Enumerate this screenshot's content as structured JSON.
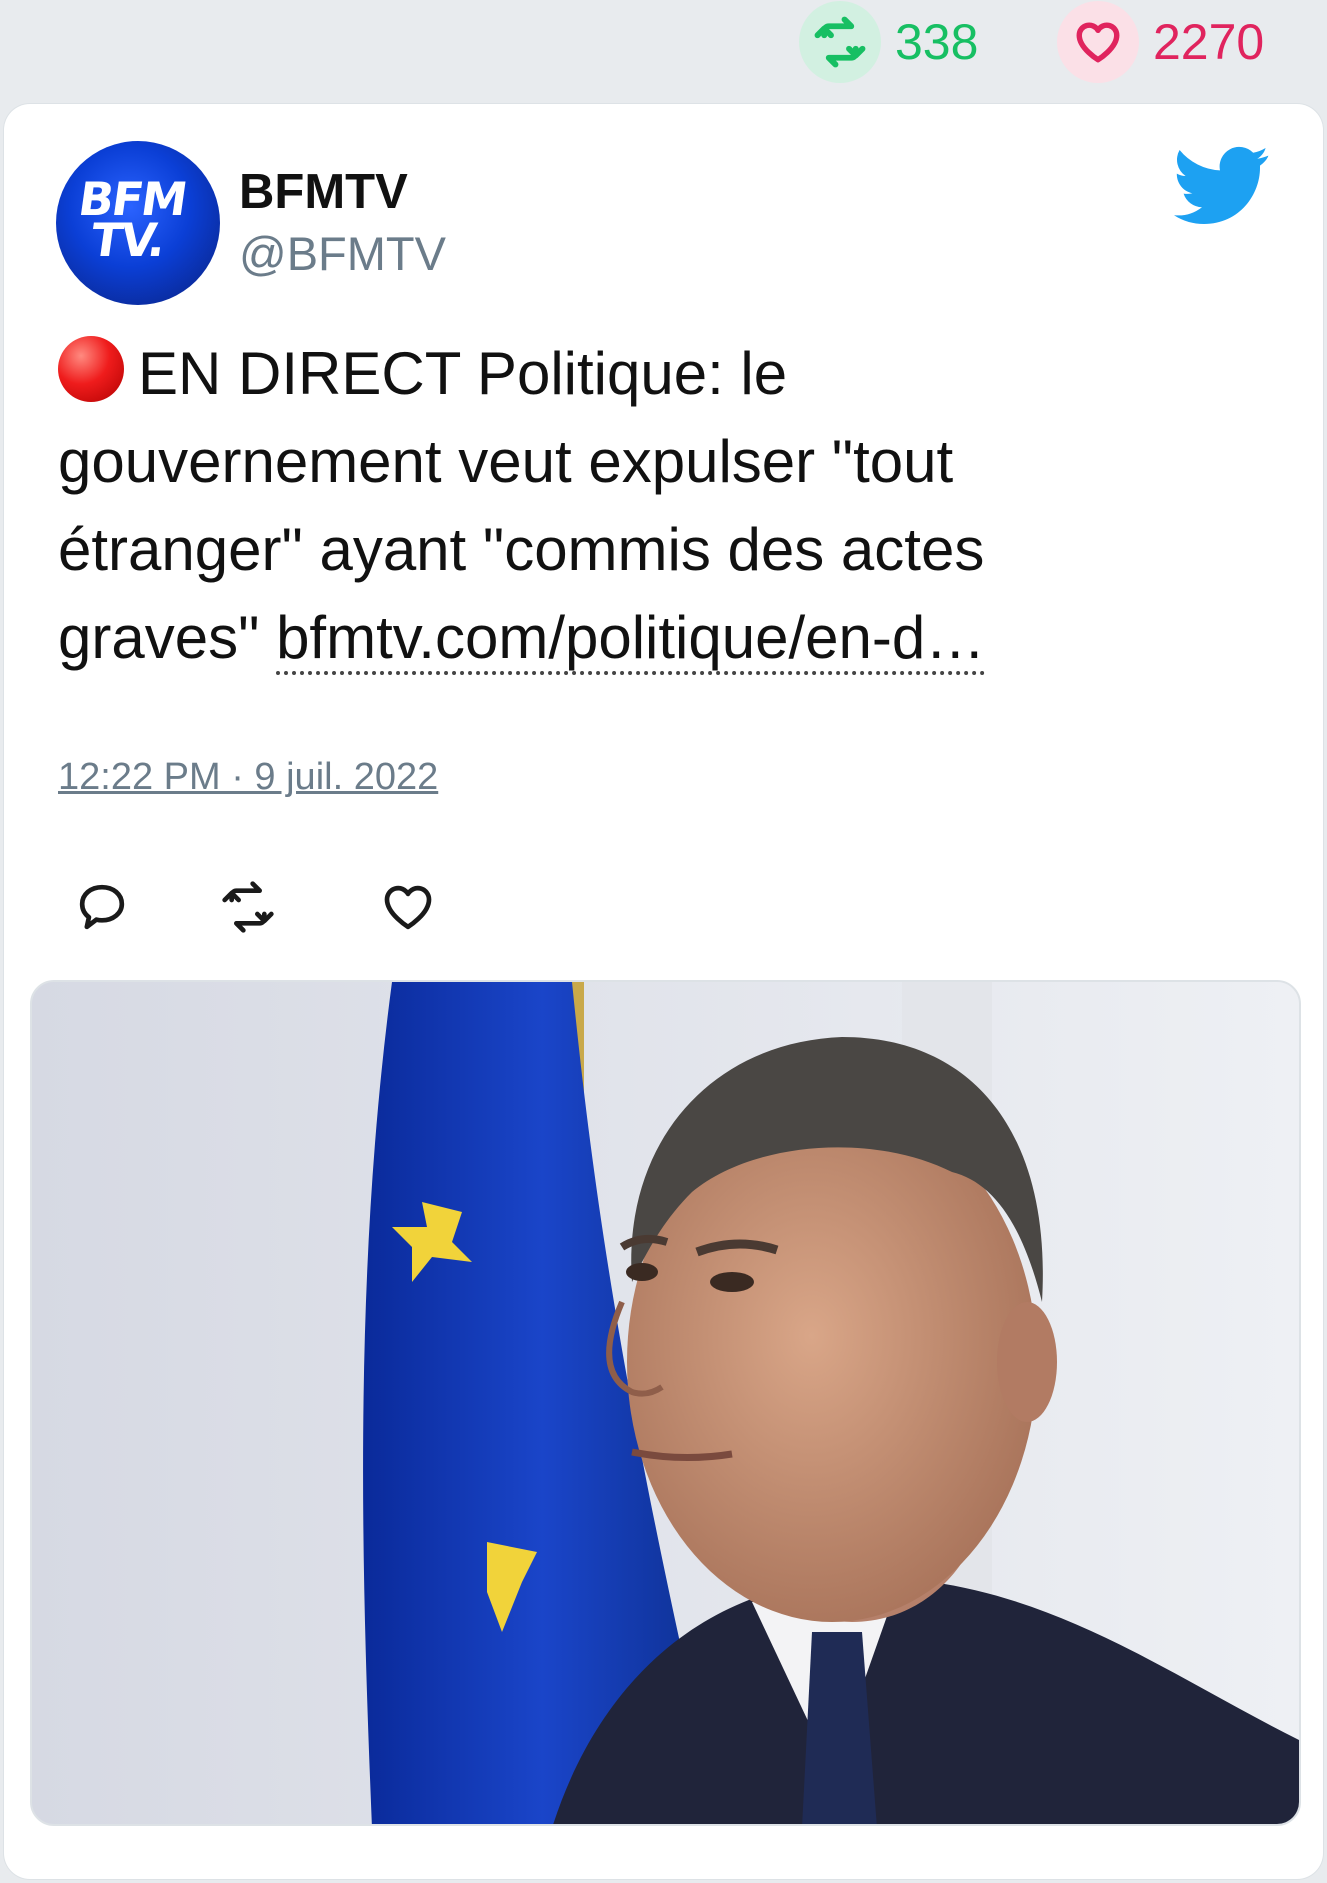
{
  "stats": {
    "retweet_icon": "retweet-icon",
    "retweets": "338",
    "like_icon": "heart-icon",
    "likes": "2270"
  },
  "author": {
    "avatar_logo_line1": "BFM",
    "avatar_logo_line2": "TV.",
    "name": "BFMTV",
    "handle": "@BFMTV"
  },
  "tweet": {
    "marker_icon": "red-circle-emoji",
    "text": "EN DIRECT Politique: le gouvernement veut expulser \"tout étranger\" ayant \"commis des actes graves\" ",
    "link": "bfmtv.com/politique/en-d…",
    "timestamp": "12:22 PM · 9 juil. 2022"
  },
  "actions": [
    "reply-icon",
    "retweet-icon",
    "like-icon"
  ],
  "colors": {
    "retweet_green": "#17bf63",
    "like_red": "#e0245e",
    "twitter_blue": "#1da1f2",
    "background": "#e8ebee"
  }
}
